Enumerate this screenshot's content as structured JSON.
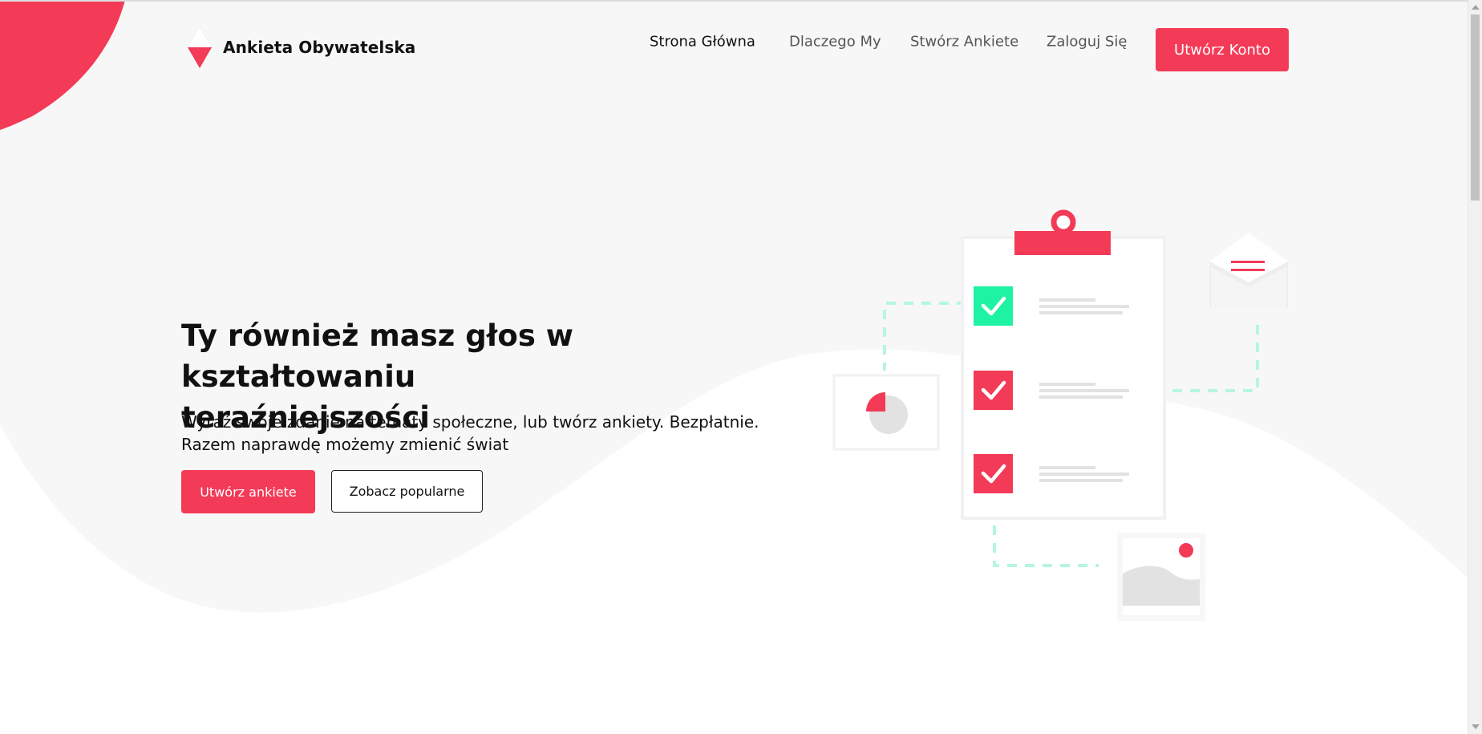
{
  "header": {
    "brand": "Ankieta Obywatelska",
    "nav": [
      {
        "label": "Strona Główna",
        "active": true
      },
      {
        "label": "Dlaczego My",
        "active": false
      },
      {
        "label": "Stwórz Ankiete",
        "active": false
      },
      {
        "label": "Zaloguj Się",
        "active": false
      }
    ],
    "register_label": "Utwórz Konto"
  },
  "hero": {
    "title_line1": "Ty również masz głos w kształtowaniu",
    "title_line2": "teraźniejszości",
    "subtitle_line1": "Wyraź swoje zdanie na tematy społeczne, lub twórz ankiety. Bezpłatnie.",
    "subtitle_line2": "Razem naprawdę możemy zmienić świat",
    "primary_button": "Utwórz ankiete",
    "secondary_button": "Zobacz popularne"
  },
  "colors": {
    "accent": "#f33a57",
    "check_green": "#1ef2a3",
    "background_gray": "#f7f7f7"
  },
  "icons": [
    "logo-triangle-icon",
    "clipboard-icon",
    "checkbox-checked-icon",
    "envelope-icon",
    "pie-chart-icon",
    "image-icon"
  ]
}
